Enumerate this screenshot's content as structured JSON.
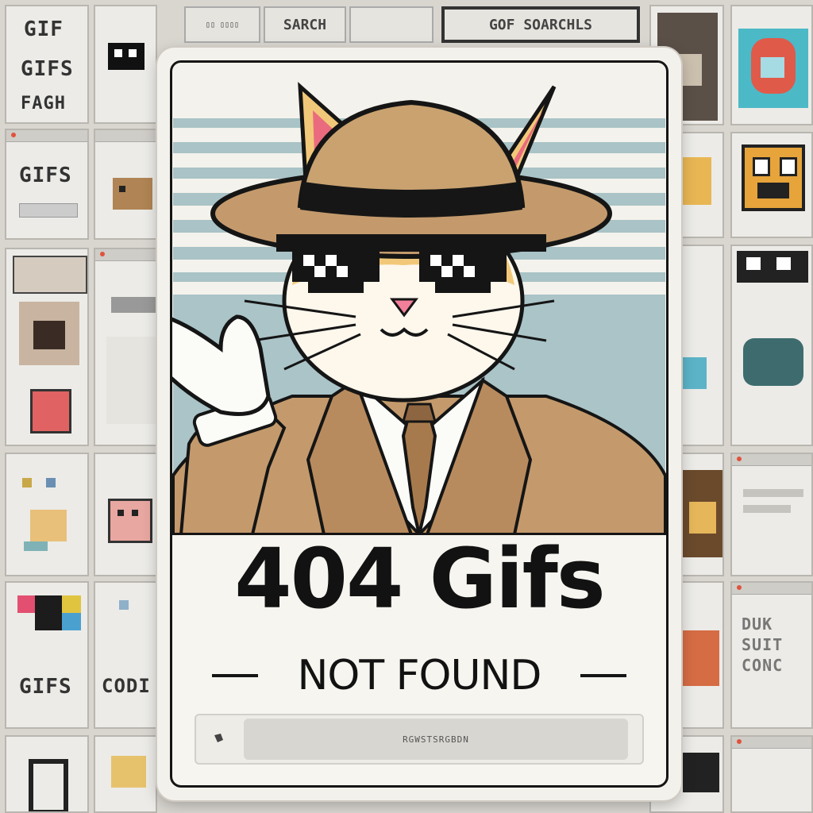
{
  "background": {
    "top_bar": [
      "SARCH",
      "GOF SOARCHLS"
    ],
    "tile_labels": [
      "GIF",
      "GIFS",
      "FAGH",
      "GIFS",
      "GIFS",
      "CODI"
    ],
    "side_text": [
      "DUK",
      "SUIT",
      "CONC"
    ]
  },
  "card": {
    "headline": "404 Gifs",
    "subtitle": "NOT FOUND",
    "search": {
      "icon": "search-icon",
      "value": "RGWSTSRGBDN"
    }
  },
  "colors": {
    "ink": "#151515",
    "card": "#f3f1ec",
    "sky": "#a9c3c6",
    "fur": "#f1c879",
    "suit": "#c49a6c",
    "nose": "#f2809a"
  }
}
